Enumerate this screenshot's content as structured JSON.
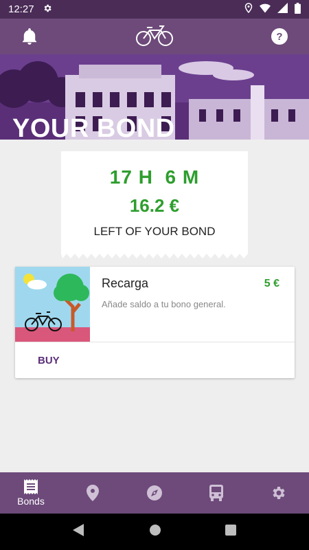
{
  "status_bar": {
    "time": "12:27"
  },
  "hero": {
    "title": "YOUR BOND"
  },
  "ticket": {
    "time_left": "17 H  6 M",
    "money_left": "16.2 €",
    "caption": "LEFT OF YOUR BOND"
  },
  "products": [
    {
      "title": "Recarga",
      "price": "5 €",
      "description": "Añade saldo a tu bono general.",
      "action": "BUY"
    }
  ],
  "bottom_nav": {
    "items": [
      {
        "label": "Bonds",
        "icon": "receipt-icon",
        "active": true
      },
      {
        "label": "",
        "icon": "location-pin-icon",
        "active": false
      },
      {
        "label": "",
        "icon": "compass-icon",
        "active": false
      },
      {
        "label": "",
        "icon": "bus-icon",
        "active": false
      },
      {
        "label": "",
        "icon": "gear-icon",
        "active": false
      }
    ]
  },
  "colors": {
    "app_bar": "#6d4a7a",
    "status_bar": "#4a2c57",
    "accent_green": "#2e9e2e",
    "buy_text": "#5a2f78"
  }
}
